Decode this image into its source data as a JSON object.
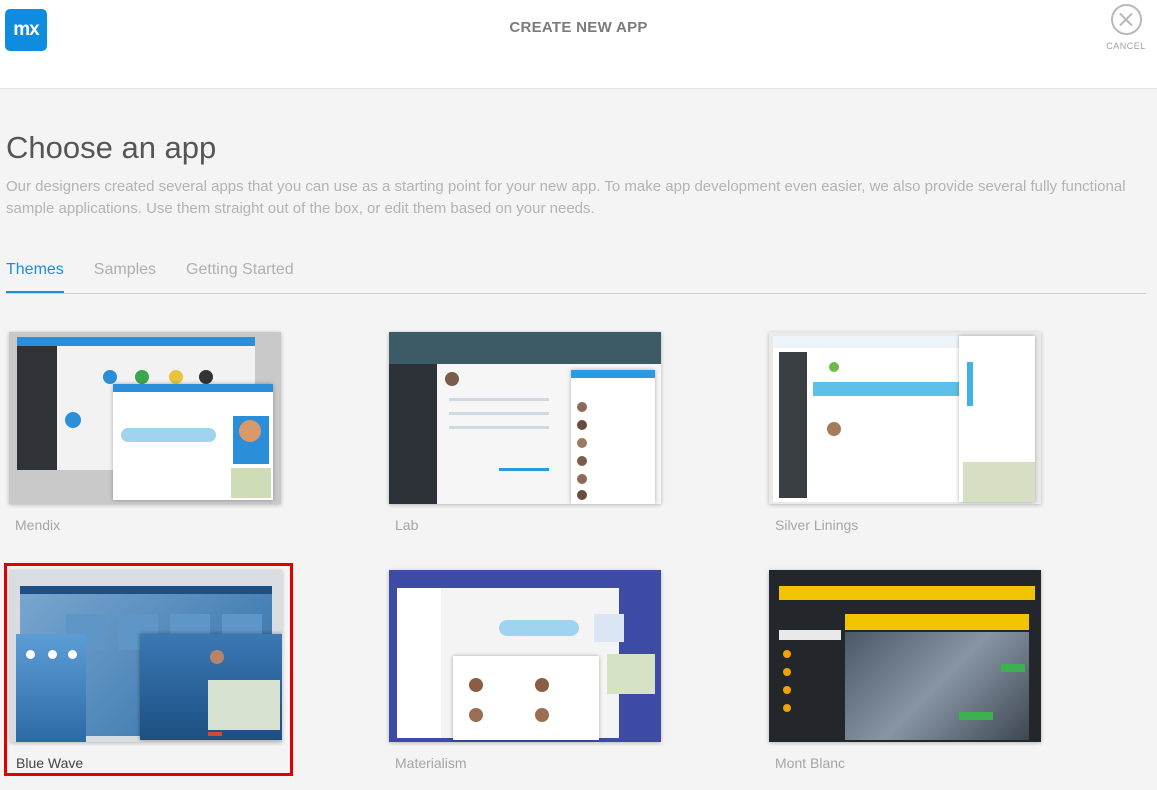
{
  "header": {
    "logo_text": "mx",
    "title": "CREATE NEW APP",
    "cancel_label": "CANCEL"
  },
  "page": {
    "heading": "Choose an app",
    "description": "Our designers created several apps that you can use as a starting point for your new app. To make app development even easier, we also provide several fully functional sample applications. Use them straight out of the box, or edit them based on your needs."
  },
  "tabs": [
    {
      "label": "Themes",
      "active": true
    },
    {
      "label": "Samples",
      "active": false
    },
    {
      "label": "Getting Started",
      "active": false
    }
  ],
  "themes": [
    {
      "name": "Mendix"
    },
    {
      "name": "Lab"
    },
    {
      "name": "Silver Linings"
    },
    {
      "name": "Blue Wave",
      "selected": true
    },
    {
      "name": "Materialism"
    },
    {
      "name": "Mont Blanc"
    }
  ],
  "colors": {
    "accent": "#1b8fd8",
    "selection": "#e10000",
    "logo": "#0d8ce0"
  }
}
